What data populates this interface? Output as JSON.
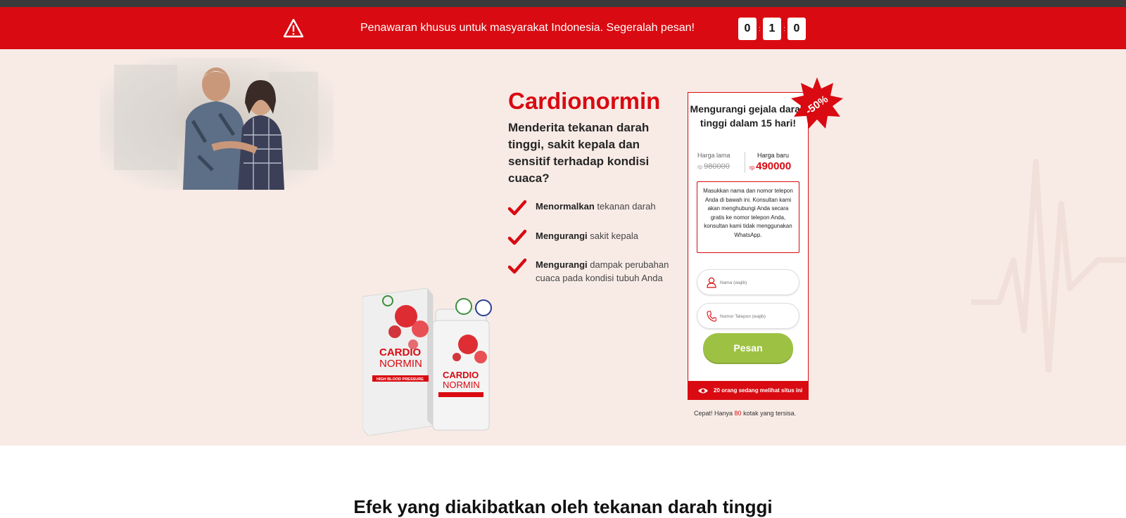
{
  "promo": {
    "message": "Penawaran khusus untuk masyarakat Indonesia. Segeralah pesan!",
    "timer": [
      "0",
      "1",
      "0"
    ],
    "separator": ":"
  },
  "hero": {
    "title": "Cardionormin",
    "subtitle": "Menderita tekanan darah tinggi, sakit kepala dan sensitif terhadap kondisi cuaca?",
    "features": [
      {
        "bold": "Menormalkan",
        "text": " tekanan darah"
      },
      {
        "bold": "Mengurangi",
        "text": " sakit kepala"
      },
      {
        "bold": "Mengurangi",
        "text": " dampak perubahan cuaca pada kondisi tubuh Anda"
      }
    ],
    "product": {
      "box_brand_line1": "CARDIO",
      "box_brand_line2": "NORMIN",
      "box_tag": "HIGH BLOOD PRESSURE"
    }
  },
  "order_form": {
    "badge": "-50%",
    "heading": "Mengurangi gejala darah tinggi dalam 15 hari!",
    "old_price_label": "Harga lama",
    "old_price_currency": "rp",
    "old_price": "980000",
    "new_price_label": "Harga baru",
    "new_price_currency": "rp",
    "new_price": "490000",
    "notice": "Masukkan nama dan nomor telepon Anda di bawah ini. Konsultan kami akan menghubungi Anda secara gratis ke nomor telepon Anda, konsultan kami tidak menggunakan WhatsApp.",
    "name_placeholder": "Nama (wajib)",
    "phone_placeholder": "Nomor Telepon (wajib)",
    "submit_label": "Pesan",
    "viewers_text": "20 orang sedang melihat situs ini",
    "stock_prefix": "Cepat! Hanya ",
    "stock_count": "80",
    "stock_suffix": " kotak yang tersisa."
  },
  "section": {
    "title": "Efek yang diakibatkan oleh tekanan darah tinggi"
  },
  "colors": {
    "brand_red": "#d90a11",
    "hero_bg": "#f8ebe6",
    "button_green": "#9dc243"
  },
  "icons": [
    "warning-icon",
    "check-icon",
    "user-icon",
    "phone-icon",
    "eye-icon"
  ]
}
